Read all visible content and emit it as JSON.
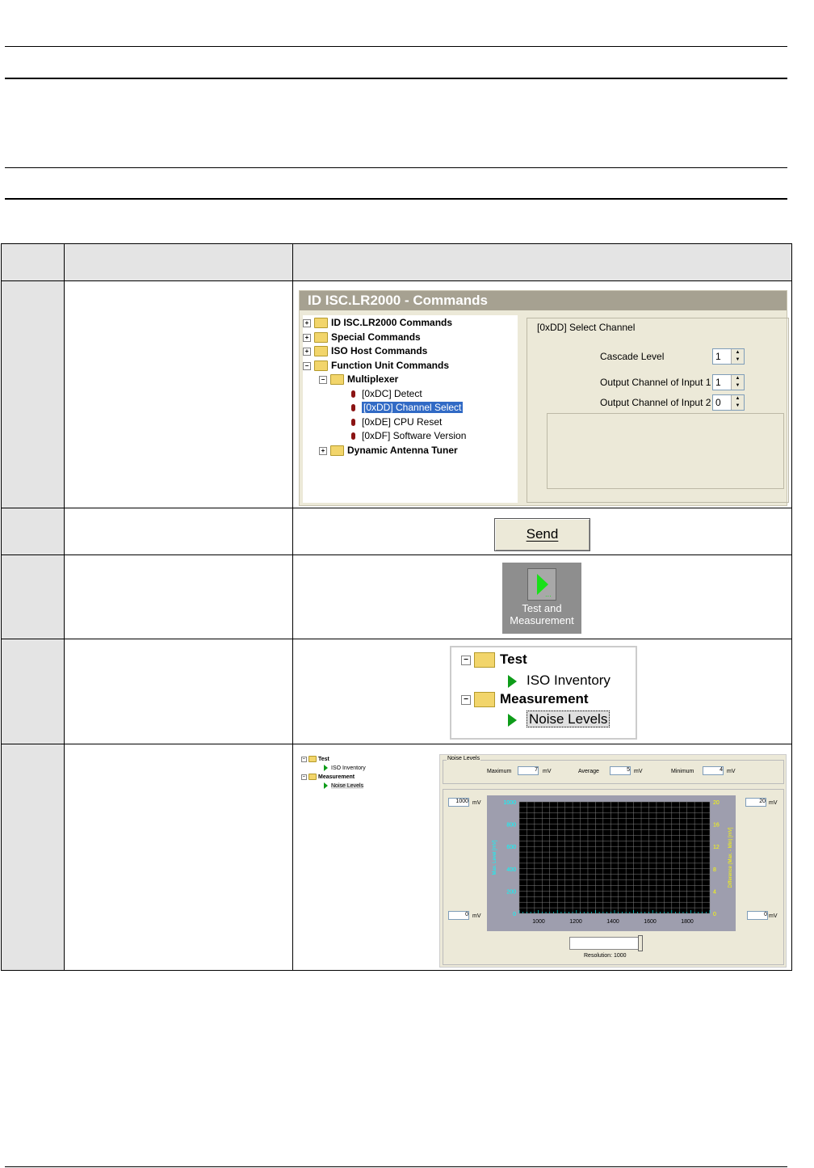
{
  "commands_panel": {
    "title": "ID ISC.LR2000 - Commands",
    "tree": [
      "ID ISC.LR2000 Commands",
      "Special Commands",
      "ISO Host Commands",
      "Function Unit Commands",
      "Multiplexer",
      "[0xDC] Detect",
      "[0xDD] Channel Select",
      "[0xDE] CPU Reset",
      "[0xDF] Software Version",
      "Dynamic Antenna Tuner"
    ],
    "group_title": "[0xDD] Select Channel",
    "fields": [
      {
        "label": "Cascade Level",
        "value": "1"
      },
      {
        "label": "Output Channel of Input 1",
        "value": "1"
      },
      {
        "label": "Output Channel of Input 2",
        "value": "0"
      }
    ]
  },
  "send_button": {
    "label": "Send"
  },
  "test_button": {
    "line1": "Test and",
    "line2": "Measurement"
  },
  "test_tree": {
    "test": "Test",
    "iso_inventory": "ISO Inventory",
    "measurement": "Measurement",
    "noise_levels": "Noise Levels"
  },
  "noise_panel": {
    "group_title": "Noise Levels",
    "maximum_label": "Maximum",
    "maximum_value": "7",
    "average_label": "Average",
    "average_value": "5",
    "minimum_label": "Minimum",
    "minimum_value": "4",
    "unit": "mV",
    "left_top": "1000",
    "left_bottom": "0",
    "right_top": "20",
    "right_bottom": "0",
    "left_axis_label": "Max. Level [mV]",
    "right_axis_label": "Difference (Max. - Min) [mV]",
    "resolution": "Resolution: 1000",
    "mini_tree": [
      "Test",
      "ISO Inventory",
      "Measurement",
      "Noise Levels"
    ]
  },
  "chart_data": {
    "type": "line",
    "x_ticks": [
      "1000",
      "1200",
      "1400",
      "1600",
      "1800"
    ],
    "left_ticks": [
      "1000",
      "800",
      "600",
      "400",
      "200",
      "0"
    ],
    "right_ticks": [
      "20",
      "16",
      "12",
      "8",
      "4",
      "0"
    ],
    "ylabel": "Max. Level [mV]",
    "y2label": "Difference (Max. - Min) [mV]",
    "ylim": [
      0,
      1000
    ],
    "y2lim": [
      0,
      20
    ],
    "grid": true,
    "colors": {
      "background": "#000000",
      "grid": "#808080",
      "left_axis": "#00ffff",
      "right_axis": "#ffff00"
    }
  }
}
